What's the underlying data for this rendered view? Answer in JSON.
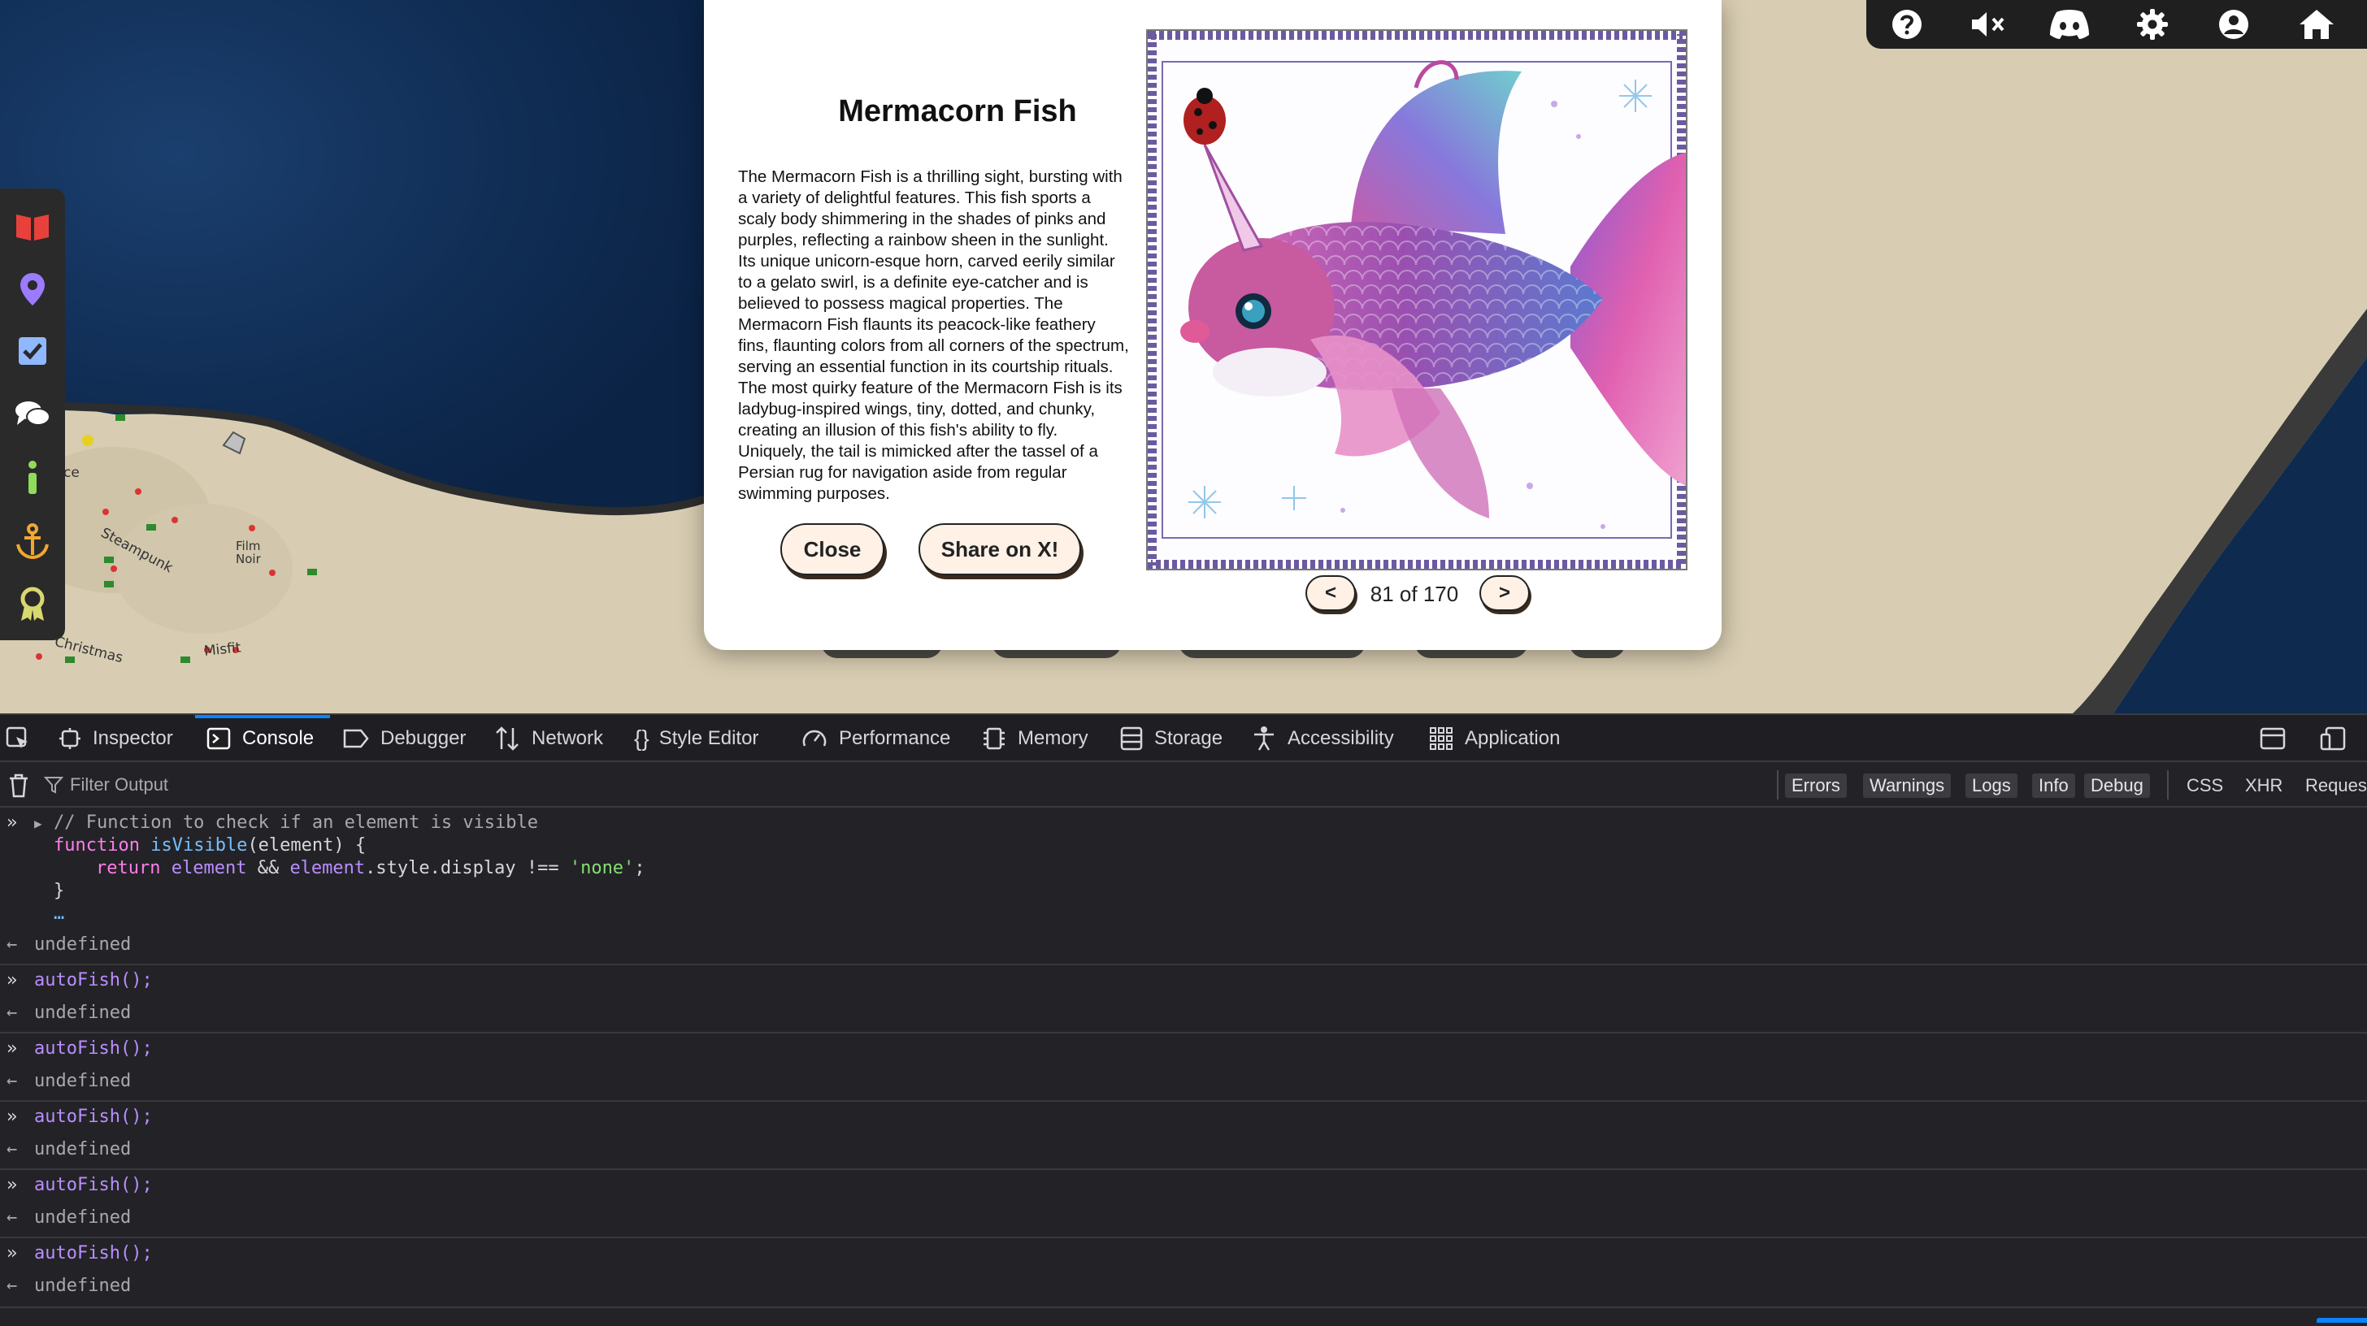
{
  "map": {
    "labels": [
      "Steampunk",
      "Film Noir",
      "Christmas",
      "Misfit",
      "ce"
    ]
  },
  "left_toolbar": {
    "icons": [
      "book-icon",
      "map-pin-icon",
      "checkbox-icon",
      "chat-icon",
      "info-icon",
      "anchor-icon",
      "award-icon"
    ],
    "colors": {
      "book": "#e8413c",
      "pin": "#9b7bff",
      "check": "#8fb8ff",
      "chat": "#ffffff",
      "info": "#8fdc5a",
      "anchor": "#f0a830",
      "award": "#d8d870"
    }
  },
  "top_toolbar": {
    "icons": [
      "help-icon",
      "mute-icon",
      "discord-icon",
      "settings-icon",
      "account-icon",
      "home-icon"
    ]
  },
  "modal": {
    "title": "Mermacorn Fish",
    "description": "The Mermacorn Fish is a thrilling sight, bursting with a variety of delightful features. This fish sports a scaly body shimmering in the shades of pinks and purples, reflecting a rainbow sheen in the sunlight. Its unique unicorn-esque horn, carved eerily similar to a gelato swirl, is a definite eye-catcher and is believed to possess magical properties. The Mermacorn Fish flaunts its peacock-like feathery fins, flaunting colors from all corners of the spectrum, serving an essential function in its courtship rituals. The most quirky feature of the Mermacorn Fish is its ladybug-inspired wings, tiny, dotted, and chunky, creating an illusion of this fish's ability to fly. Uniquely, the tail is mimicked after the tassel of a Persian rug for navigation aside from regular swimming purposes.",
    "close_label": "Close",
    "share_label": "Share on X!",
    "prev_label": "<",
    "next_label": ">",
    "page_indicator": "81 of 170"
  },
  "devtools": {
    "tabs": [
      "Inspector",
      "Console",
      "Debugger",
      "Network",
      "Style Editor",
      "Performance",
      "Memory",
      "Storage",
      "Accessibility",
      "Application"
    ],
    "active_tab": "Console",
    "filter_placeholder": "Filter Output",
    "filter_chips": [
      "Errors",
      "Warnings",
      "Logs",
      "Info",
      "Debug"
    ],
    "extra_filters": [
      "CSS",
      "XHR",
      "Reques"
    ],
    "console": {
      "first_input": {
        "line1": "// Function to check if an element is visible",
        "line2_kw": "function",
        "line2_fn": "isVisible",
        "line2_rest": "(element) {",
        "line3_kw": "return",
        "line3_a": "element",
        "line3_b": " && ",
        "line3_c": "element",
        "line3_d": ".style.display !== ",
        "line3_str": "'none'",
        "line3_end": ";",
        "line4": "}",
        "line5": "…"
      },
      "result": "undefined",
      "entries": [
        {
          "input": "autoFish();",
          "output": "undefined"
        },
        {
          "input": "autoFish();",
          "output": "undefined"
        },
        {
          "input": "autoFish();",
          "output": "undefined"
        },
        {
          "input": "autoFish();",
          "output": "undefined"
        },
        {
          "input": "autoFish();",
          "output": "undefined"
        }
      ]
    }
  }
}
